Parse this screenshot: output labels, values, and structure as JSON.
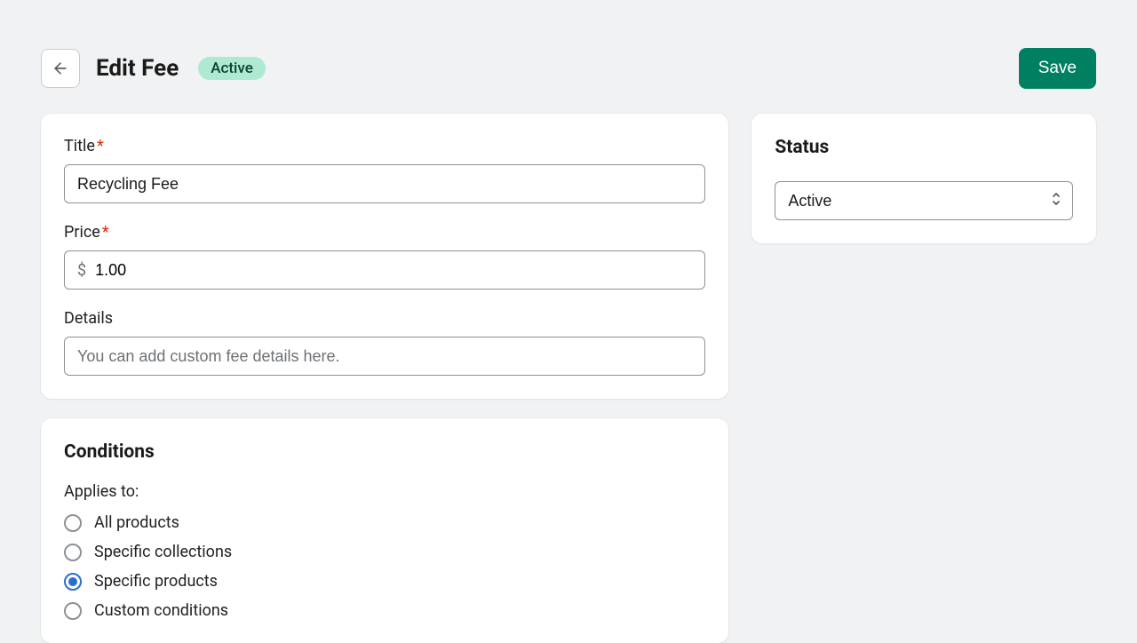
{
  "header": {
    "title": "Edit Fee",
    "badge": "Active",
    "save_label": "Save"
  },
  "form": {
    "title_label": "Title",
    "title_value": "Recycling Fee",
    "price_label": "Price",
    "price_prefix": "$",
    "price_value": "1.00",
    "details_label": "Details",
    "details_placeholder": "You can add custom fee details here."
  },
  "conditions": {
    "heading": "Conditions",
    "applies_label": "Applies to:",
    "options": [
      {
        "label": "All products",
        "selected": false
      },
      {
        "label": "Specific collections",
        "selected": false
      },
      {
        "label": "Specific products",
        "selected": true
      },
      {
        "label": "Custom conditions",
        "selected": false
      }
    ]
  },
  "status": {
    "heading": "Status",
    "value": "Active"
  }
}
